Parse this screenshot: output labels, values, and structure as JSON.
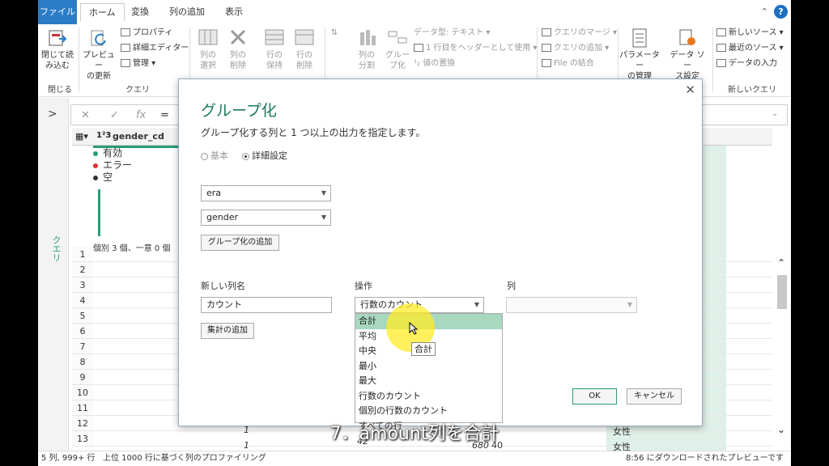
{
  "ribbon": {
    "tabs": {
      "file": "ファイル",
      "home": "ホーム",
      "transform": "変換",
      "add_column": "列の追加",
      "view": "表示"
    },
    "help": "?",
    "buttons": {
      "close_load": "閉じて読\nみ込む",
      "preview_refresh": "プレビュー\nの更新",
      "properties": "プロパティ",
      "advanced_editor": "詳細エディター",
      "manage": "管理",
      "choose_columns": "列の\n選択",
      "remove_columns": "列の\n削除",
      "keep_rows": "行の\n保持",
      "remove_rows": "行の\n削除",
      "split_column": "列の\n分割",
      "group_by": "グルー\nプ化",
      "data_type": "データ型: テキスト",
      "first_row_header": "1 行目をヘッダーとして使用",
      "replace_values": "値の置換",
      "merge_queries": "クエリのマージ",
      "append_queries": "クエリの追加",
      "combine_files": "File の結合",
      "parameters": "パラメーター\nの管理",
      "data_source": "データ ソー\nス設定",
      "new_source": "新しいソース",
      "recent_sources": "最近のソース",
      "enter_data": "データの入力"
    },
    "groups": {
      "close": "閉じる",
      "query": "クエリ",
      "new_query": "新しいクエリ"
    }
  },
  "query_pane": {
    "label": "クエリ",
    "expand": ">"
  },
  "formula_bar": {
    "cancel": "✕",
    "commit": "✓",
    "fx": "fx",
    "eq": "="
  },
  "grid": {
    "column_header": "gender_cd",
    "type_badge": "1²3",
    "profile": {
      "valid": "有効",
      "error": "エラー",
      "empty": "空",
      "distinct": "個別 3 個、一意 0 個"
    },
    "row_numbers": [
      "1",
      "2",
      "3",
      "4",
      "5",
      "6",
      "7",
      "8",
      "9",
      "10",
      "11",
      "12",
      "13"
    ],
    "row12": {
      "a": "1",
      "b": "女性"
    },
    "row13": {
      "a": "1",
      "b": "42",
      "c": "680",
      "d": "40",
      "e": "女性"
    }
  },
  "status": {
    "left": "5 列, 999+ 行",
    "middle": "上位 1000 行に基づく列のプロファイリング",
    "right": "8:56 にダウンロードされたプレビューです"
  },
  "dialog": {
    "title": "グループ化",
    "description": "グループ化する列と 1 つ以上の出力を指定します。",
    "radio_basic": "基本",
    "radio_advanced": "詳細設定",
    "group_cols": [
      "era",
      "gender"
    ],
    "add_grouping": "グループ化の追加",
    "labels": {
      "new_col": "新しい列名",
      "operation": "操作",
      "column": "列"
    },
    "new_col_value": "カウント",
    "operation_value": "行数のカウント",
    "add_aggregation": "集計の追加",
    "operations": [
      "合計",
      "平均",
      "中央",
      "最小",
      "最大",
      "行数のカウント",
      "個別の行数のカウント",
      "すべての行"
    ],
    "tooltip": "合計",
    "ok": "OK",
    "cancel": "キャンセル"
  },
  "subtitle": "7．amount列を合計",
  "colors": {
    "accent": "#1e7a5a",
    "file_tab": "#2b7cc4",
    "selected": "#a8d8c0",
    "highlight": "#ffeb28"
  }
}
